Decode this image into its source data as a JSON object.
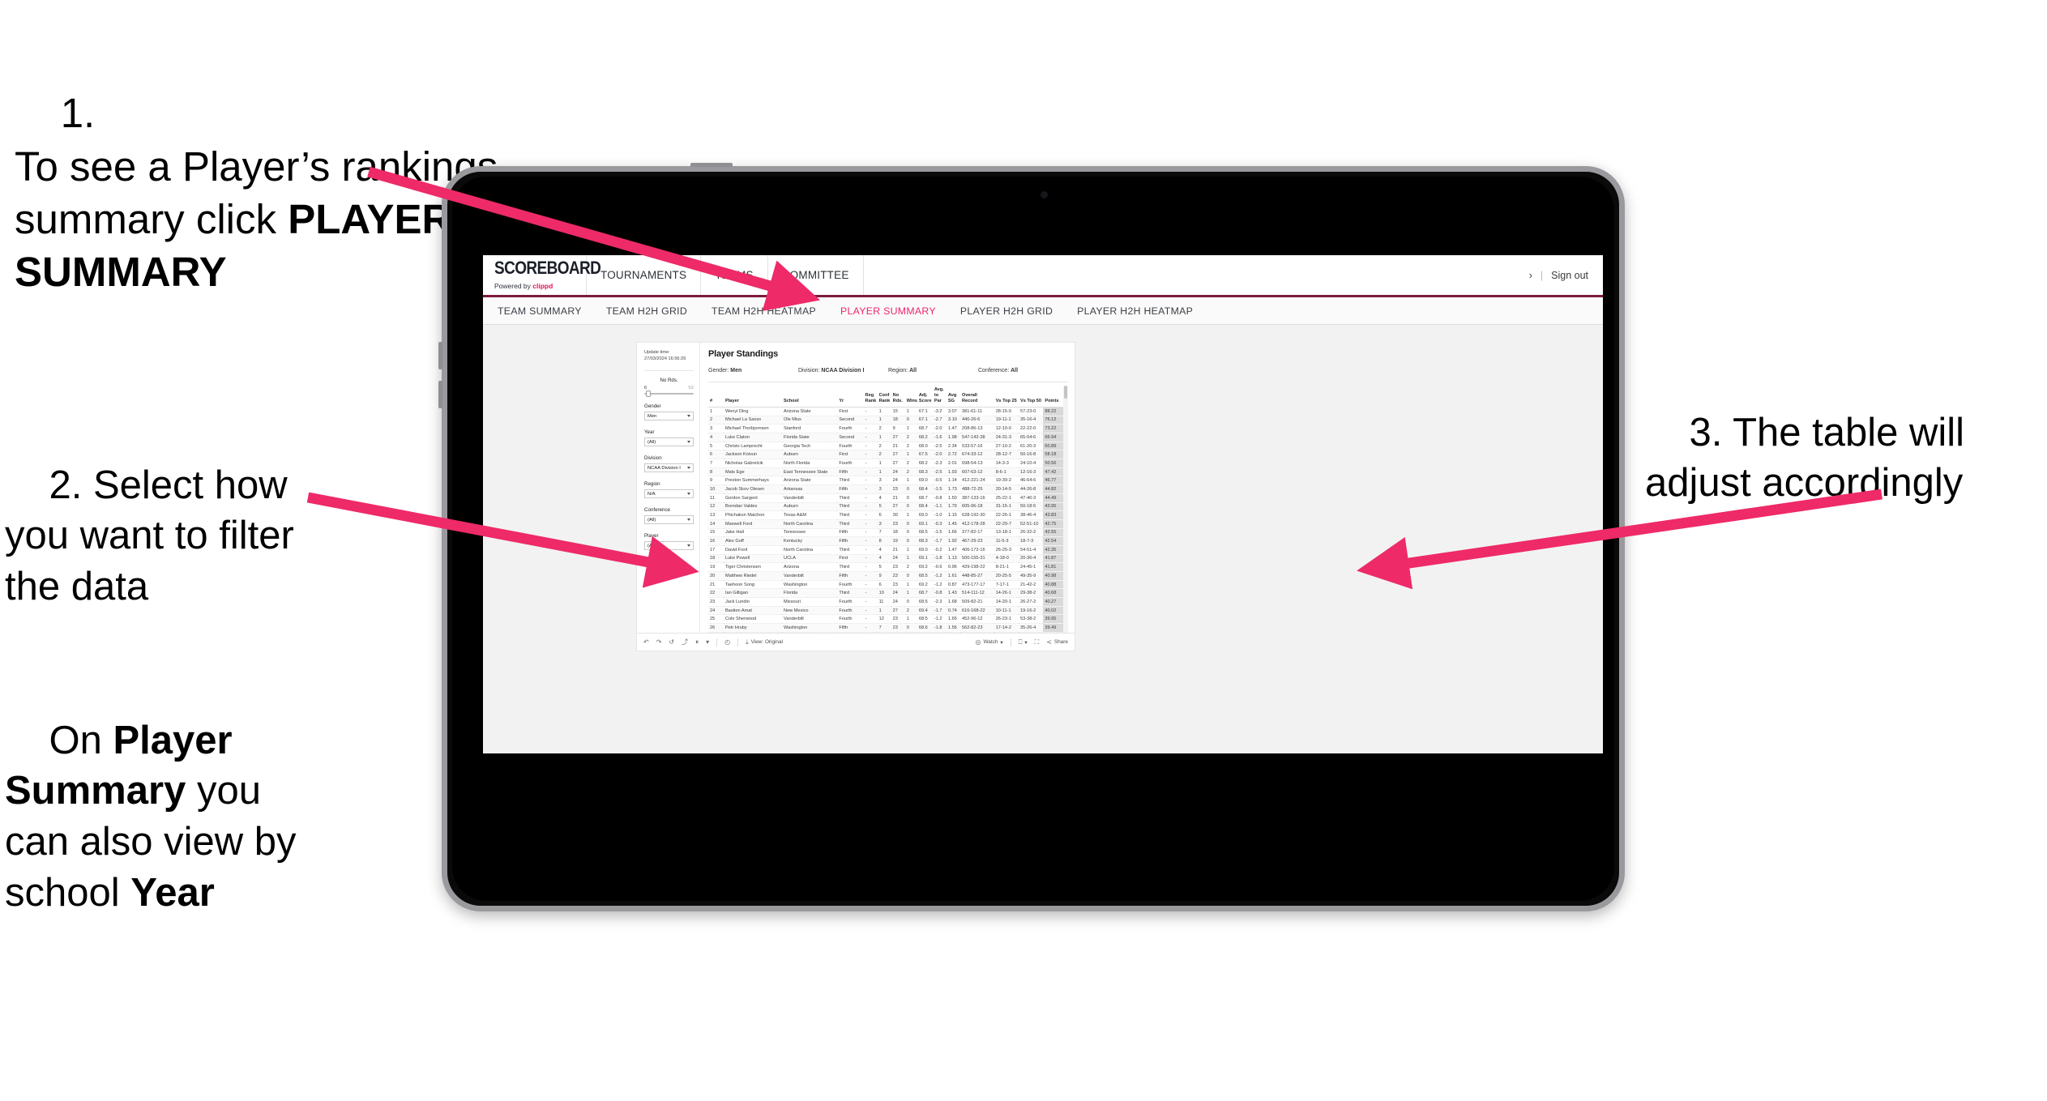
{
  "annotations": {
    "step1": {
      "number": "1.",
      "text_a": "To see a Player’s rankings summary click ",
      "text_b": "PLAYER SUMMARY"
    },
    "step2": {
      "text": "2. Select how you want to filter the data"
    },
    "step2b": {
      "pre": "On ",
      "bold1": "Player Summary",
      "mid": " you can also view by school ",
      "bold2": "Year"
    },
    "step3": {
      "text": "3. The table will adjust accordingly"
    },
    "arrow_color": "#ee2a68"
  },
  "app": {
    "logo": {
      "main": "SCOREBOARD",
      "sub_pre": "Powered by ",
      "sub_brand": "clippd"
    },
    "top_nav": [
      {
        "label": "TOURNAMENTS"
      },
      {
        "label": "TEAMS"
      },
      {
        "label": "COMMITTEE"
      }
    ],
    "header_right": {
      "user": "›",
      "separator": "|",
      "sign_out": "Sign out"
    },
    "sub_nav": [
      {
        "label": "TEAM SUMMARY",
        "active": false
      },
      {
        "label": "TEAM H2H GRID",
        "active": false
      },
      {
        "label": "TEAM H2H HEATMAP",
        "active": false
      },
      {
        "label": "PLAYER SUMMARY",
        "active": true
      },
      {
        "label": "PLAYER H2H GRID",
        "active": false
      },
      {
        "label": "PLAYER H2H HEATMAP",
        "active": false
      }
    ],
    "accent_color": "#f0256f",
    "header_underline_color": "#7c1b3b"
  },
  "viz": {
    "update_label": "Update time:",
    "update_time": "27/03/2024 16:56:26",
    "title": "Player Standings",
    "meta": [
      {
        "label": "Gender:",
        "value": "Men"
      },
      {
        "label": "Division:",
        "value": "NCAA Division I"
      },
      {
        "label": "Region:",
        "value": "All"
      },
      {
        "label": "Conference:",
        "value": "All"
      }
    ],
    "filters": {
      "no_rds": {
        "label": "No Rds.",
        "min": "6",
        "max": "52"
      },
      "gender": {
        "label": "Gender",
        "value": "Men"
      },
      "year": {
        "label": "Year",
        "value": "(All)"
      },
      "division": {
        "label": "Division",
        "value": "NCAA Division I"
      },
      "region": {
        "label": "Region",
        "value": "N/A"
      },
      "conference": {
        "label": "Conference",
        "value": "(All)"
      },
      "player": {
        "label": "Player",
        "value": "(All)"
      }
    },
    "toolbar": {
      "undo_icon": "↶",
      "redo_icon": "↷",
      "revert_icon": "↺",
      "refresh_icon": "⤴",
      "pause_icon": "⏸",
      "clock_icon": "◴",
      "view_icon": "⤓",
      "view_label": "View: Original",
      "watch_label": "Watch",
      "watch_icon": "◎",
      "caret": "▾",
      "alert_icon": "⎕",
      "fullscreen_icon": "⛶",
      "share_icon": "≺",
      "share_label": "Share"
    }
  },
  "chart_data": {
    "type": "table",
    "title": "Player Standings",
    "columns": [
      "#",
      "Player",
      "School",
      "Yr",
      "Reg Rank",
      "Conf Rank",
      "No Rds.",
      "Wins",
      "Adj. Score",
      "Avg. to Par",
      "Avg SG",
      "Overall Record",
      "Vs Top 25",
      "Vs Top 50",
      "Points"
    ],
    "rows": [
      [
        "1",
        "Wenyi Ding",
        "Arizona State",
        "First",
        "-",
        "1",
        "15",
        "1",
        "67.1",
        "-3.2",
        "3.07",
        "381-61-11",
        "28-15-0",
        "57-23-0",
        "88.22"
      ],
      [
        "2",
        "Michael La Sasso",
        "Ole Miss",
        "Second",
        "-",
        "1",
        "18",
        "0",
        "67.1",
        "-2.7",
        "3.10",
        "440-26-6",
        "19-11-1",
        "35-16-4",
        "76.12"
      ],
      [
        "3",
        "Michael Thorbjornsen",
        "Stanford",
        "Fourth",
        "-",
        "2",
        "9",
        "1",
        "68.7",
        "-2.0",
        "1.47",
        "208-86-13",
        "12-10-0",
        "22-22-0",
        "73.22"
      ],
      [
        "4",
        "Luke Claton",
        "Florida State",
        "Second",
        "-",
        "1",
        "27",
        "2",
        "68.2",
        "-1.6",
        "1.98",
        "547-142-38",
        "24-31-3",
        "65-54-6",
        "66.94"
      ],
      [
        "5",
        "Christo Lamprecht",
        "Georgia Tech",
        "Fourth",
        "-",
        "2",
        "21",
        "2",
        "68.0",
        "-2.5",
        "2.34",
        "533-57-16",
        "27-10-2",
        "61-20-3",
        "60.89"
      ],
      [
        "6",
        "Jackson Koivun",
        "Auburn",
        "First",
        "-",
        "2",
        "27",
        "1",
        "67.5",
        "-2.0",
        "2.72",
        "674-33-12",
        "28-12-7",
        "50-16-8",
        "58.18"
      ],
      [
        "7",
        "Nicholas Gabrelcik",
        "North Florida",
        "Fourth",
        "-",
        "1",
        "27",
        "2",
        "68.2",
        "-2.3",
        "2.01",
        "698-54-13",
        "14-3-3",
        "24-10-4",
        "50.56"
      ],
      [
        "8",
        "Mats Ege",
        "East Tennessee State",
        "Fifth",
        "-",
        "1",
        "24",
        "2",
        "68.3",
        "-2.5",
        "1.93",
        "607-63-12",
        "8-6-1",
        "12-16-3",
        "47.42"
      ],
      [
        "9",
        "Preston Summerhays",
        "Arizona State",
        "Third",
        "-",
        "3",
        "24",
        "1",
        "69.0",
        "-0.5",
        "1.14",
        "412-221-24",
        "19-39-2",
        "46-64-6",
        "46.77"
      ],
      [
        "10",
        "Jacob Skov Olesen",
        "Arkansas",
        "Fifth",
        "-",
        "3",
        "23",
        "0",
        "68.4",
        "-1.5",
        "1.73",
        "488-72-25",
        "20-14-5",
        "44-26-8",
        "44.82"
      ],
      [
        "11",
        "Gordon Sargent",
        "Vanderbilt",
        "Third",
        "-",
        "4",
        "21",
        "0",
        "68.7",
        "-0.8",
        "1.50",
        "387-133-16",
        "25-22-1",
        "47-40-3",
        "44.49"
      ],
      [
        "12",
        "Brendan Valdes",
        "Auburn",
        "Third",
        "-",
        "5",
        "27",
        "0",
        "68.4",
        "-1.1",
        "1.79",
        "605-96-18",
        "31-15-1",
        "50-18-5",
        "43.95"
      ],
      [
        "13",
        "Phichaksn Maichon",
        "Texas A&M",
        "Third",
        "-",
        "6",
        "30",
        "1",
        "69.0",
        "-1.0",
        "1.15",
        "628-192-30",
        "22-26-1",
        "38-46-4",
        "43.83"
      ],
      [
        "14",
        "Maxwell Ford",
        "North Carolina",
        "Third",
        "-",
        "3",
        "23",
        "0",
        "69.1",
        "-0.3",
        "1.45",
        "412-178-28",
        "22-29-7",
        "52-51-10",
        "42.75"
      ],
      [
        "15",
        "Jake Hall",
        "Tennessee",
        "Fifth",
        "-",
        "7",
        "18",
        "0",
        "68.5",
        "-1.5",
        "1.66",
        "377-82-17",
        "13-18-1",
        "26-32-2",
        "42.55"
      ],
      [
        "16",
        "Alex Goff",
        "Kentucky",
        "Fifth",
        "-",
        "8",
        "19",
        "0",
        "68.3",
        "-1.7",
        "1.92",
        "467-29-23",
        "11-5-3",
        "18-7-3",
        "42.54"
      ],
      [
        "17",
        "David Ford",
        "North Carolina",
        "Third",
        "-",
        "4",
        "21",
        "1",
        "69.0",
        "-0.2",
        "1.47",
        "406-172-16",
        "26-25-3",
        "54-51-4",
        "42.35"
      ],
      [
        "18",
        "Luke Powell",
        "UCLA",
        "First",
        "-",
        "4",
        "24",
        "1",
        "69.1",
        "-1.8",
        "1.13",
        "500-155-31",
        "4-18-0",
        "20-36-4",
        "41.87"
      ],
      [
        "19",
        "Tiger Christensen",
        "Arizona",
        "Third",
        "-",
        "5",
        "23",
        "2",
        "69.2",
        "-0.6",
        "0.96",
        "429-198-22",
        "8-21-1",
        "24-45-1",
        "41.81"
      ],
      [
        "20",
        "Matthew Riedel",
        "Vanderbilt",
        "Fifth",
        "-",
        "9",
        "23",
        "0",
        "68.5",
        "-1.2",
        "1.61",
        "448-85-27",
        "20-25-5",
        "49-35-9",
        "40.98"
      ],
      [
        "21",
        "Taehoon Song",
        "Washington",
        "Fourth",
        "-",
        "6",
        "23",
        "1",
        "69.2",
        "-1.2",
        "0.87",
        "473-177-17",
        "7-17-1",
        "21-42-2",
        "40.88"
      ],
      [
        "22",
        "Ian Gilligan",
        "Florida",
        "Third",
        "-",
        "10",
        "24",
        "1",
        "68.7",
        "-0.8",
        "1.43",
        "514-111-12",
        "14-26-1",
        "29-38-2",
        "40.68"
      ],
      [
        "23",
        "Jack Lundin",
        "Missouri",
        "Fourth",
        "-",
        "11",
        "24",
        "0",
        "68.5",
        "-2.3",
        "1.68",
        "509-82-21",
        "14-20-1",
        "26-27-2",
        "40.27"
      ],
      [
        "24",
        "Bastien Amat",
        "New Mexico",
        "Fourth",
        "-",
        "1",
        "27",
        "2",
        "69.4",
        "-1.7",
        "0.74",
        "616-168-22",
        "10-11-1",
        "19-16-2",
        "40.02"
      ],
      [
        "25",
        "Cole Sherwood",
        "Vanderbilt",
        "Fourth",
        "-",
        "12",
        "23",
        "1",
        "68.5",
        "-1.2",
        "1.65",
        "452-96-12",
        "26-23-1",
        "53-38-2",
        "39.95"
      ],
      [
        "26",
        "Petr Hruby",
        "Washington",
        "Fifth",
        "-",
        "7",
        "23",
        "0",
        "68.6",
        "-1.8",
        "1.56",
        "562-82-23",
        "17-14-2",
        "35-26-4",
        "39.49"
      ]
    ]
  }
}
